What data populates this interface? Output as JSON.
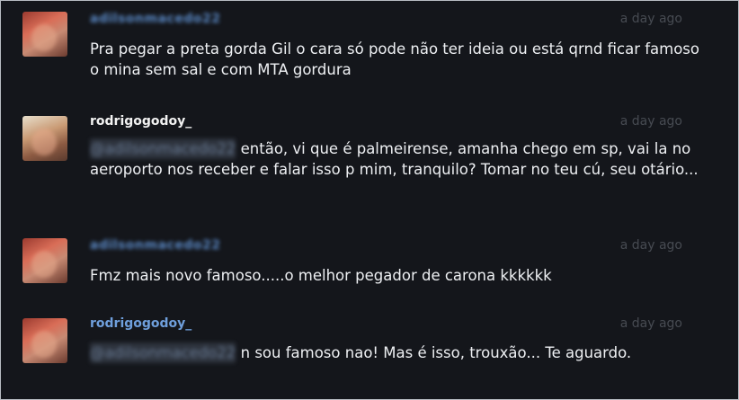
{
  "comments": [
    {
      "username": "adilsonmacedo22",
      "time": "a day ago",
      "text": "Pra pegar a preta gorda Gil o cara só pode não ter ideia ou está qrnd ficar famoso o mina sem sal e com MTA gordura"
    },
    {
      "username": "rodrigogodoy_",
      "time": "a day ago",
      "mention": "@adilsonmacedo22",
      "text": "então, vi que é palmeirense, amanha chego em sp, vai la no aeroporto nos receber e falar isso p mim, tranquilo? Tomar no teu cú, seu otário..."
    },
    {
      "username": "adilsonmacedo22",
      "time": "a day ago",
      "text": "Fmz mais novo famoso.....o melhor pegador de carona kkkkkk"
    },
    {
      "username": "rodrigogodoy_",
      "time": "a day ago",
      "mention": "@adilsonmacedo22",
      "text": "n sou famoso nao! Mas é isso, trouxão... Te aguardo."
    }
  ]
}
